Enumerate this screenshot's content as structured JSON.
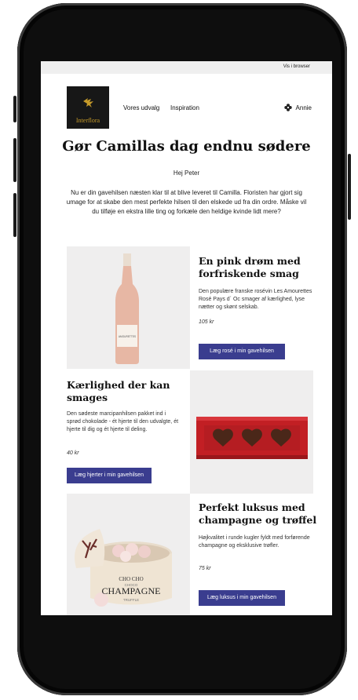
{
  "topbar": {
    "view_in_browser": "Vis i browser"
  },
  "header": {
    "logo_text": "Interflora",
    "nav": [
      "Vores udvalg",
      "Inspiration"
    ],
    "user_name": "Annie"
  },
  "main": {
    "title": "Gør Camillas dag endnu sødere",
    "greeting": "Hej Peter",
    "intro": "Nu er din gavehilsen næsten klar til at blive leveret til Camilla. Floristen har gjort sig umage for at skabe den mest perfekte hilsen til den elskede ud fra din ordre. Måske vil du tilføje en ekstra lille ting og forkæle den heldige kvinde lidt mere?"
  },
  "products": [
    {
      "title": "En pink drøm med forfriskende smag",
      "description": "Den populære franske rosévin Les Amourettes Rosé Pays d´ Oc smager af kærlighed, lyse nætter og skønt selskab.",
      "price": "105 kr",
      "cta": "Læg rosé i min gavehilsen",
      "bottle_label": "AMOURETTES"
    },
    {
      "title": "Kærlighed der kan smages",
      "description": "Den sødeste marcipanhilsen pakket ind i sprød chokolade - ét hjerte til den udvalgte, ét hjerte til dig og ét hjerte til deling.",
      "price": "40 kr",
      "cta": "Læg hjerter i min gavehilsen"
    },
    {
      "title": "Perfekt luksus med champagne og trøffel",
      "description": "Højkvalitet i runde kugler fyldt med forførende champagne og eksklusive trøfler.",
      "price": "75 kr",
      "cta": "Læg luksus i min gavehilsen",
      "box_brand": "CHO CHO",
      "box_sub": "CHOCO",
      "box_label": "CHAMPAGNE",
      "box_small": "TRUFFLE"
    }
  ],
  "colors": {
    "cta_bg": "#3a3d8f",
    "logo_gold": "#c59a2a",
    "logo_bg": "#171717"
  }
}
